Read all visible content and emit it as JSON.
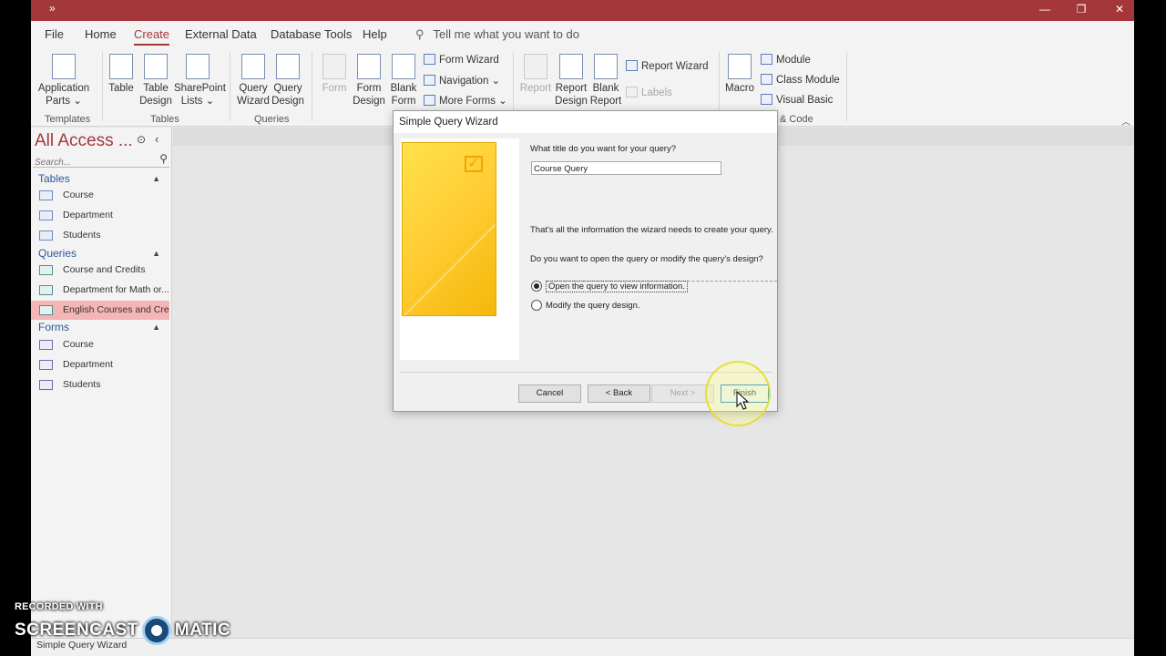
{
  "window": {
    "chevron": "»",
    "minimize": "—",
    "restore": "❐",
    "close": "✕"
  },
  "menu": {
    "tabs": [
      {
        "label": "File"
      },
      {
        "label": "Home"
      },
      {
        "label": "Create"
      },
      {
        "label": "External Data"
      },
      {
        "label": "Database Tools"
      },
      {
        "label": "Help"
      }
    ],
    "active_tab": "Create",
    "tell_me": "Tell me what you want to do"
  },
  "ribbon": {
    "groups": {
      "templates": "Templates",
      "tables": "Tables",
      "queries": "Queries",
      "code": "& Code"
    },
    "buttons": {
      "app_parts_1": "Application",
      "app_parts_2": "Parts ⌄",
      "table": "Table",
      "table_design_1": "Table",
      "table_design_2": "Design",
      "sharepoint_1": "SharePoint",
      "sharepoint_2": "Lists ⌄",
      "query_wizard_1": "Query",
      "query_wizard_2": "Wizard",
      "query_design_1": "Query",
      "query_design_2": "Design",
      "form": "Form",
      "form_design_1": "Form",
      "form_design_2": "Design",
      "blank_form_1": "Blank",
      "blank_form_2": "Form",
      "form_wizard": "Form Wizard",
      "navigation": "Navigation ⌄",
      "more_forms": "More Forms ⌄",
      "report": "Report",
      "report_design_1": "Report",
      "report_design_2": "Design",
      "blank_report_1": "Blank",
      "blank_report_2": "Report",
      "report_wizard": "Report Wizard",
      "labels": "Labels",
      "macro": "Macro",
      "module": "Module",
      "class_module": "Class Module",
      "visual_basic": "Visual Basic"
    }
  },
  "nav": {
    "title": "All Access ...",
    "menu_icon": "⊙",
    "back_icon": "‹",
    "search_placeholder": "Search...",
    "groups": {
      "tables": "Tables",
      "queries": "Queries",
      "forms": "Forms"
    },
    "tables": [
      "Course",
      "Department",
      "Students"
    ],
    "queries": [
      "Course and Credits",
      "Department for Math or...",
      "English Courses and Cre..."
    ],
    "forms": [
      "Course",
      "Department",
      "Students"
    ]
  },
  "dialog": {
    "title": "Simple Query Wizard",
    "question": "What title do you want for your query?",
    "query_title": "Course Query",
    "info": "That's all the information the wizard needs to create your query.",
    "ask": "Do you want to open the query or modify the query's design?",
    "option_open": "Open the query to view information.",
    "option_modify": "Modify the query design.",
    "selected_option": "open",
    "buttons": {
      "cancel": "Cancel",
      "back": "< Back",
      "next": "Next >",
      "finish": "Finish"
    }
  },
  "status": {
    "text": "Simple Query Wizard"
  },
  "watermark": {
    "top": "RECORDED WITH",
    "left": "SCREENCAST",
    "right": "MATIC"
  }
}
